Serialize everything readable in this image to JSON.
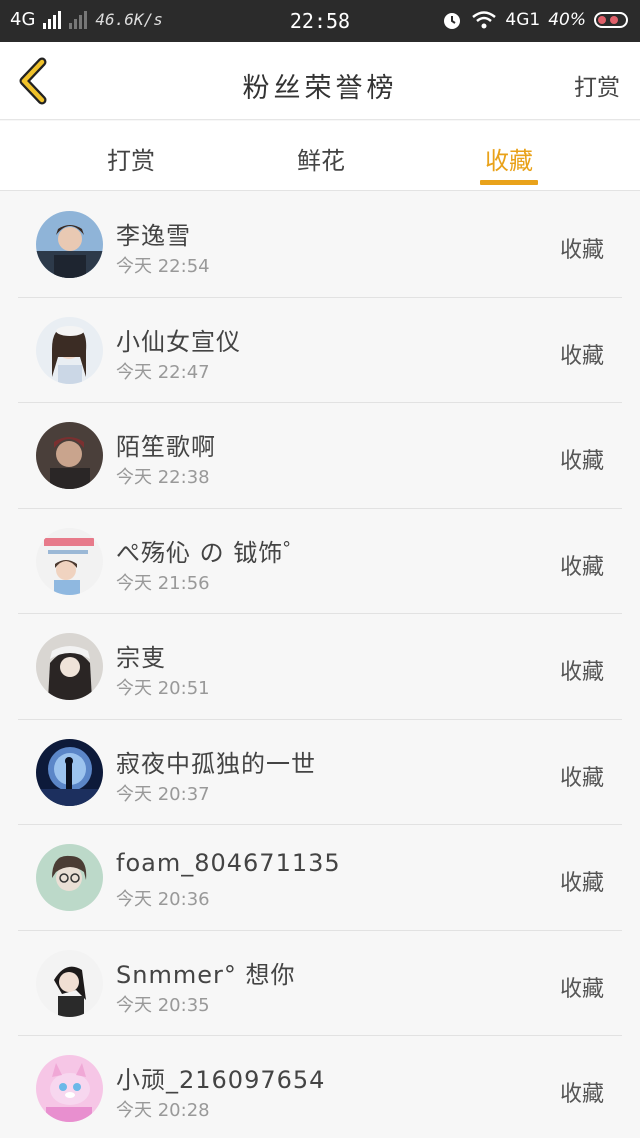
{
  "status_bar": {
    "network": "4G",
    "speed": "46.6K/s",
    "time": "22:58",
    "network_right": "4G1",
    "battery": "40%"
  },
  "header": {
    "title": "粉丝荣誉榜",
    "right_label": "打赏"
  },
  "tabs": [
    {
      "label": "打赏"
    },
    {
      "label": "鲜花"
    },
    {
      "label": "收藏"
    }
  ],
  "active_tab": "收藏",
  "accent_color": "#e9a21a",
  "fans": [
    {
      "name": "李逸雪",
      "time": "今天 22:54",
      "action": "收藏"
    },
    {
      "name": "小仙女宣仪",
      "time": "今天 22:47",
      "action": "收藏"
    },
    {
      "name": "陌笙歌啊",
      "time": "今天 22:38",
      "action": "收藏"
    },
    {
      "name": "ぺ殇伈 の 钺饰゜",
      "time": "今天 21:56",
      "action": "收藏"
    },
    {
      "name": "宗叓",
      "time": "今天 20:51",
      "action": "收藏"
    },
    {
      "name": "寂夜中孤独的一世",
      "time": "今天 20:37",
      "action": "收藏"
    },
    {
      "name": "foam_804671135",
      "time": "今天 20:36",
      "action": "收藏"
    },
    {
      "name": "Snmmer° 想你",
      "time": "今天 20:35",
      "action": "收藏"
    },
    {
      "name": "小顽_216097654",
      "time": "今天 20:28",
      "action": "收藏"
    }
  ]
}
